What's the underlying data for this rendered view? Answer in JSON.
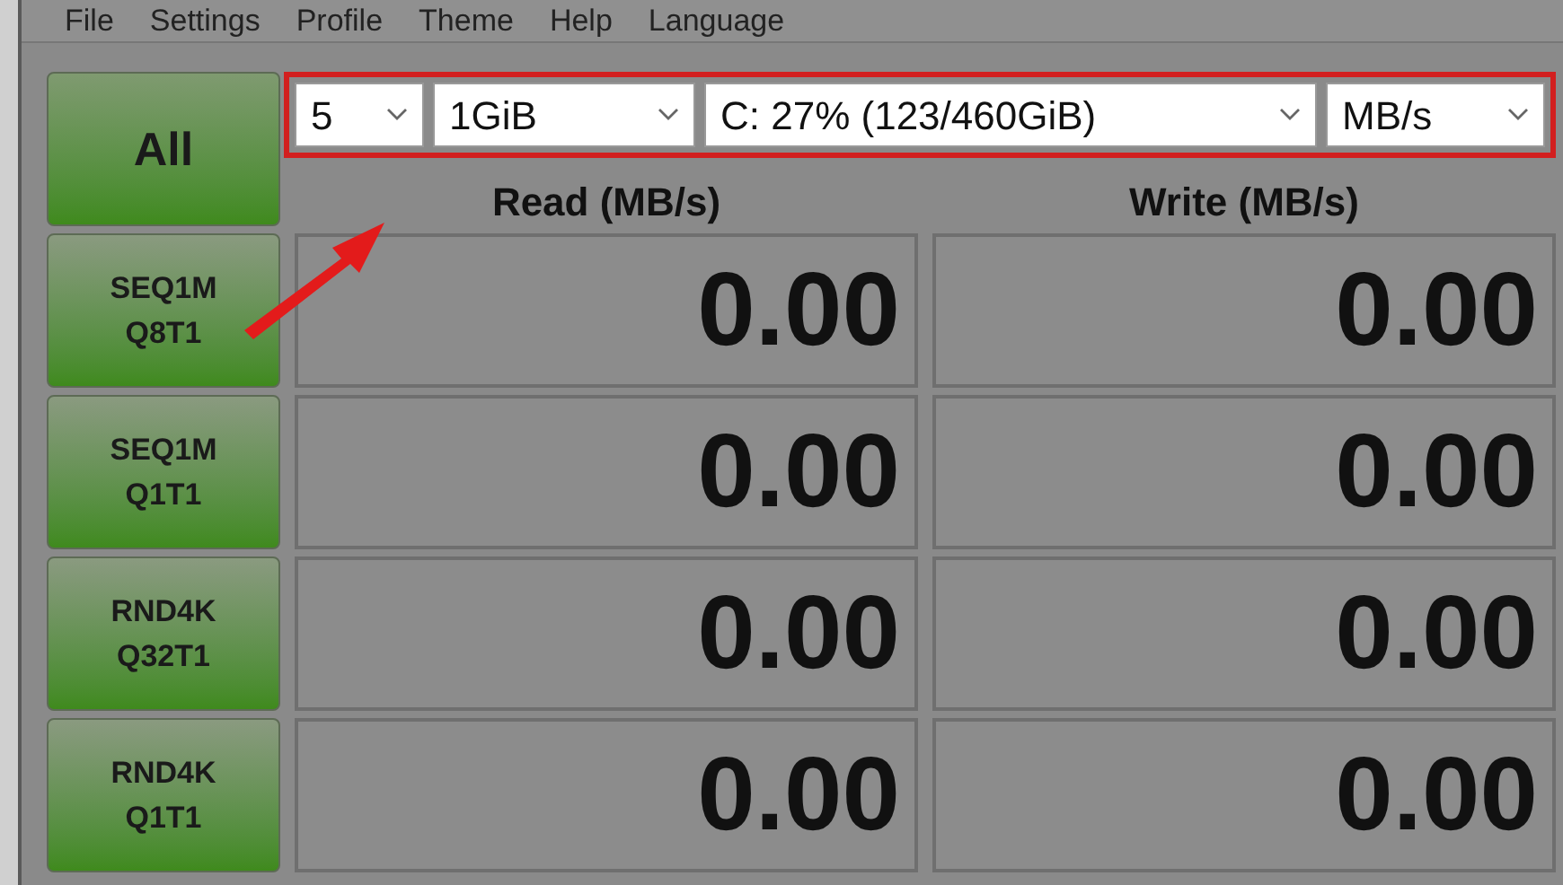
{
  "menu": [
    "File",
    "Settings",
    "Profile",
    "Theme",
    "Help",
    "Language"
  ],
  "all_button": "All",
  "dropdowns": [
    {
      "value": "5"
    },
    {
      "value": "1GiB"
    },
    {
      "value": "C: 27% (123/460GiB)"
    },
    {
      "value": "MB/s"
    }
  ],
  "columns": [
    "Read (MB/s)",
    "Write (MB/s)"
  ],
  "rows": [
    {
      "test": [
        "SEQ1M",
        "Q8T1"
      ],
      "read": "0.00",
      "write": "0.00"
    },
    {
      "test": [
        "SEQ1M",
        "Q1T1"
      ],
      "read": "0.00",
      "write": "0.00"
    },
    {
      "test": [
        "RND4K",
        "Q32T1"
      ],
      "read": "0.00",
      "write": "0.00"
    },
    {
      "test": [
        "RND4K",
        "Q1T1"
      ],
      "read": "0.00",
      "write": "0.00"
    }
  ]
}
